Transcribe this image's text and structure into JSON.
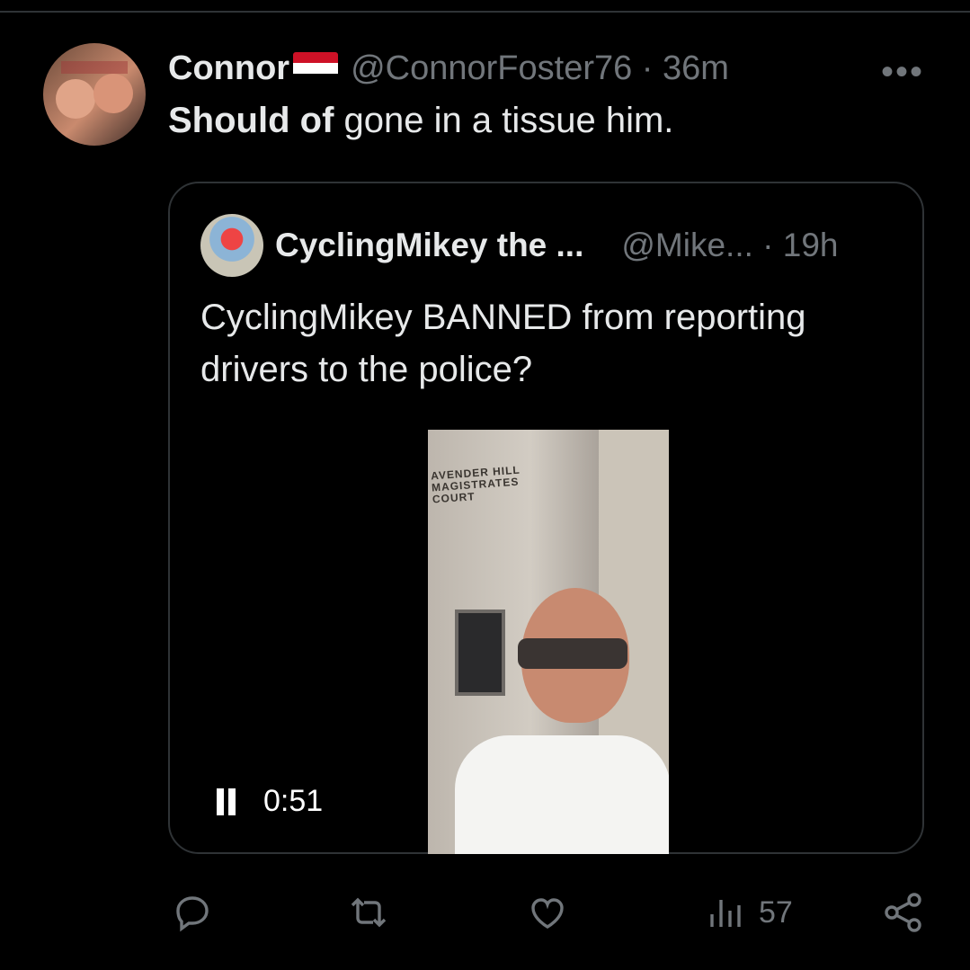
{
  "tweet": {
    "author_name": "Connor",
    "handle_time": "@ConnorFoster76 · 36m",
    "text_bold": "Should of",
    "text_rest": " gone in a tissue him."
  },
  "quote": {
    "author_name": "CyclingMikey the ...",
    "handle_time": "@Mike... · 19h",
    "text": "CyclingMikey BANNED from reporting drivers to the police?",
    "video": {
      "sign_text": "AVENDER HILL\nMAGISTRATES\nCOURT",
      "time": "0:51"
    }
  },
  "actions": {
    "views": "57"
  },
  "icons": {
    "more": "more-horizontal-icon",
    "reply": "reply-icon",
    "retweet": "retweet-icon",
    "like": "heart-icon",
    "views": "views-icon",
    "share": "share-icon",
    "pause": "pause-icon"
  },
  "colors": {
    "background": "#000000",
    "text": "#e7e9ea",
    "secondary": "#71767b",
    "border": "#2f3336"
  }
}
